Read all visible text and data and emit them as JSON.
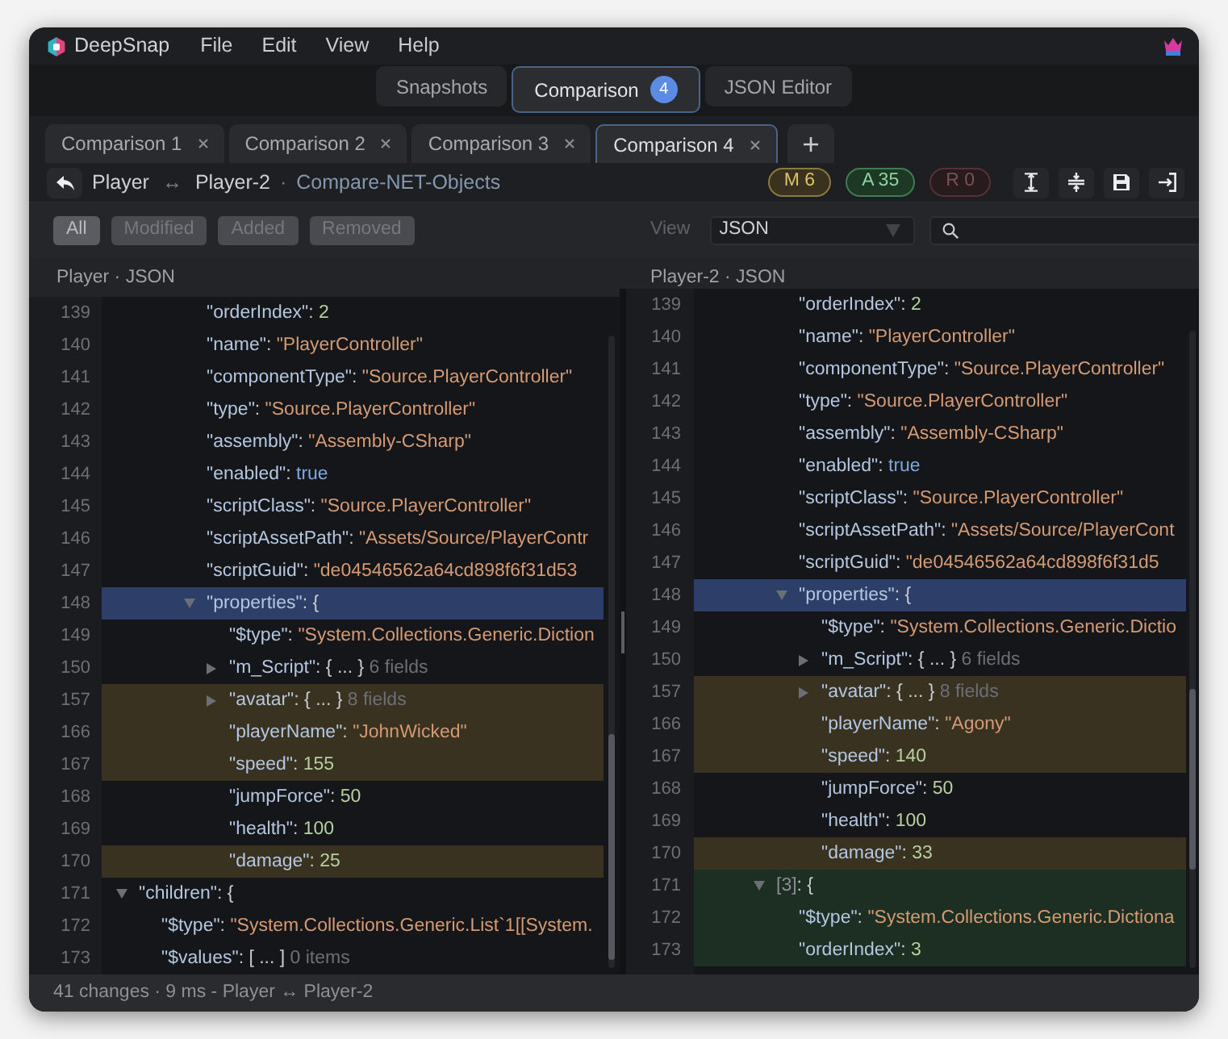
{
  "menu_bar": {
    "app_name": "DeepSnap",
    "menus": [
      "File",
      "Edit",
      "View",
      "Help"
    ]
  },
  "view_tabs": [
    {
      "label": "Snapshots",
      "selected": false
    },
    {
      "label": "Comparison",
      "selected": true,
      "badge": "4"
    },
    {
      "label": "JSON Editor",
      "selected": false
    }
  ],
  "comparison_tabs": [
    {
      "label": "Comparison 1",
      "selected": false
    },
    {
      "label": "Comparison 2",
      "selected": false
    },
    {
      "label": "Comparison 3",
      "selected": false
    },
    {
      "label": "Comparison 4",
      "selected": true
    }
  ],
  "breadcrumb": {
    "left": "Player",
    "link": "↔",
    "right": "Player-2",
    "separator": "·",
    "source": "Compare-NET-Objects"
  },
  "change_badges": [
    {
      "kind": "modified",
      "label": "M 6"
    },
    {
      "kind": "added",
      "label": "A 35"
    },
    {
      "kind": "removed",
      "label": "R 0"
    }
  ],
  "filters": [
    {
      "label": "All",
      "selected": true
    },
    {
      "label": "Modified",
      "selected": false
    },
    {
      "label": "Added",
      "selected": false
    },
    {
      "label": "Removed",
      "selected": false
    }
  ],
  "view_select": {
    "label": "View",
    "value": "JSON"
  },
  "panes": [
    {
      "title": "Player · JSON",
      "rows": [
        [
          [
            [
              {
                "line": "139",
                "selected": false,
                "modified": false,
                "added": false,
                "tokens": [
                  {
                    "kind": "key",
                    "text": "\"orderIndex\""
                  },
                  {
                    "kind": "punct",
                    "text": ": "
                  },
                  {
                    "kind": "number",
                    "text": "2"
                  }
                ]
              },
              {
                "line": "140",
                "selected": false,
                "modified": false,
                "added": false,
                "tokens": [
                  {
                    "kind": "key",
                    "text": "\"name\""
                  },
                  {
                    "kind": "punct",
                    "text": ": "
                  },
                  {
                    "kind": "string",
                    "text": "\"PlayerController\""
                  }
                ]
              },
              {
                "line": "141",
                "selected": false,
                "modified": false,
                "added": false,
                "tokens": [
                  {
                    "kind": "key",
                    "text": "\"componentType\""
                  },
                  {
                    "kind": "punct",
                    "text": ": "
                  },
                  {
                    "kind": "string",
                    "text": "\"Source.PlayerController\""
                  }
                ]
              },
              {
                "line": "142",
                "selected": false,
                "modified": false,
                "added": false,
                "tokens": [
                  {
                    "kind": "key",
                    "text": "\"type\""
                  },
                  {
                    "kind": "punct",
                    "text": ": "
                  },
                  {
                    "kind": "string",
                    "text": "\"Source.PlayerController\""
                  }
                ]
              },
              {
                "line": "143",
                "selected": false,
                "modified": false,
                "added": false,
                "tokens": [
                  {
                    "kind": "key",
                    "text": "\"assembly\""
                  },
                  {
                    "kind": "punct",
                    "text": ": "
                  },
                  {
                    "kind": "string",
                    "text": "\"Assembly-CSharp\""
                  }
                ]
              },
              {
                "line": "144",
                "selected": false,
                "modified": false,
                "added": false,
                "tokens": [
                  {
                    "kind": "key",
                    "text": "\"enabled\""
                  },
                  {
                    "kind": "punct",
                    "text": ": "
                  },
                  {
                    "kind": "bool",
                    "text": "true"
                  }
                ]
              },
              {
                "line": "145",
                "selected": false,
                "modified": false,
                "added": false,
                "tokens": [
                  {
                    "kind": "key",
                    "text": "\"scriptClass\""
                  },
                  {
                    "kind": "punct",
                    "text": ": "
                  },
                  {
                    "kind": "string",
                    "text": "\"Source.PlayerController\""
                  }
                ]
              },
              {
                "line": "146",
                "selected": false,
                "modified": false,
                "added": false,
                "tokens": [
                  {
                    "kind": "key",
                    "text": "\"scriptAssetPath\""
                  },
                  {
                    "kind": "punct",
                    "text": ": "
                  },
                  {
                    "kind": "string",
                    "text": "\"Assets/Source/PlayerContr"
                  }
                ]
              },
              {
                "line": "147",
                "selected": false,
                "modified": false,
                "added": false,
                "tokens": [
                  {
                    "kind": "key",
                    "text": "\"scriptGuid\""
                  },
                  {
                    "kind": "punct",
                    "text": ": "
                  },
                  {
                    "kind": "string",
                    "text": "\"de04546562a64cd898f6f31d53"
                  }
                ]
              },
              {
                "line": "148",
                "selected": true,
                "modified": false,
                "added": false,
                "expanded": true,
                "tokens": [
                  {
                    "kind": "key",
                    "text": "\"properties\""
                  },
                  {
                    "kind": "punct",
                    "text": ": {"
                  }
                ],
                "children": [
                  {
                    "line": "149",
                    "selected": false,
                    "modified": false,
                    "added": false,
                    "tokens": [
                      {
                        "kind": "key",
                        "text": "\"$type\""
                      },
                      {
                        "kind": "punct",
                        "text": ": "
                      },
                      {
                        "kind": "string",
                        "text": "\"System.Collections.Generic.Diction"
                      }
                    ]
                  },
                  {
                    "line": "150",
                    "selected": false,
                    "modified": false,
                    "added": false,
                    "expanded": false,
                    "tokens": [
                      {
                        "kind": "key",
                        "text": "\"m_Script\""
                      },
                      {
                        "kind": "punct",
                        "text": ": { ... } "
                      },
                      {
                        "kind": "summary",
                        "text": "6 fields"
                      }
                    ]
                  },
                  {
                    "line": "157",
                    "selected": false,
                    "modified": true,
                    "added": false,
                    "expanded": false,
                    "tokens": [
                      {
                        "kind": "key",
                        "text": "\"avatar\""
                      },
                      {
                        "kind": "punct",
                        "text": ": { ... } "
                      },
                      {
                        "kind": "summary",
                        "text": "8 fields"
                      }
                    ]
                  },
                  {
                    "line": "166",
                    "selected": false,
                    "modified": true,
                    "added": false,
                    "tokens": [
                      {
                        "kind": "key",
                        "text": "\"playerName\""
                      },
                      {
                        "kind": "punct",
                        "text": ": "
                      },
                      {
                        "kind": "string",
                        "text": "\"JohnWicked\""
                      }
                    ]
                  },
                  {
                    "line": "167",
                    "selected": false,
                    "modified": true,
                    "added": false,
                    "tokens": [
                      {
                        "kind": "key",
                        "text": "\"speed\""
                      },
                      {
                        "kind": "punct",
                        "text": ": "
                      },
                      {
                        "kind": "number",
                        "text": "155"
                      }
                    ]
                  },
                  {
                    "line": "168",
                    "selected": false,
                    "modified": false,
                    "added": false,
                    "tokens": [
                      {
                        "kind": "key",
                        "text": "\"jumpForce\""
                      },
                      {
                        "kind": "punct",
                        "text": ": "
                      },
                      {
                        "kind": "number",
                        "text": "50"
                      }
                    ]
                  },
                  {
                    "line": "169",
                    "selected": false,
                    "modified": false,
                    "added": false,
                    "tokens": [
                      {
                        "kind": "key",
                        "text": "\"health\""
                      },
                      {
                        "kind": "punct",
                        "text": ": "
                      },
                      {
                        "kind": "number",
                        "text": "100"
                      }
                    ]
                  },
                  {
                    "line": "170",
                    "selected": false,
                    "modified": true,
                    "added": false,
                    "tokens": [
                      {
                        "kind": "key",
                        "text": "\"damage\""
                      },
                      {
                        "kind": "punct",
                        "text": ": "
                      },
                      {
                        "kind": "number",
                        "text": "25"
                      }
                    ]
                  }
                ]
              }
            ]
          ]
        ],
        {
          "line": "171",
          "selected": false,
          "modified": false,
          "added": false,
          "expanded": true,
          "tokens": [
            {
              "kind": "key",
              "text": "\"children\""
            },
            {
              "kind": "punct",
              "text": ": {"
            }
          ],
          "children": [
            {
              "line": "172",
              "selected": false,
              "modified": false,
              "added": false,
              "tokens": [
                {
                  "kind": "key",
                  "text": "\"$type\""
                },
                {
                  "kind": "punct",
                  "text": ": "
                },
                {
                  "kind": "string",
                  "text": "\"System.Collections.Generic.List`1[[System."
                }
              ]
            },
            {
              "line": "173",
              "selected": false,
              "modified": false,
              "added": false,
              "tokens": [
                {
                  "kind": "key",
                  "text": "\"$values\""
                },
                {
                  "kind": "punct",
                  "text": ": [ ... ] "
                },
                {
                  "kind": "summary",
                  "text": "0 items"
                }
              ]
            }
          ]
        }
      ]
    },
    {
      "title": "Player-2 · JSON",
      "rows": [
        [
          [
            [
              {
                "line": "139",
                "selected": false,
                "modified": false,
                "added": false,
                "tokens": [
                  {
                    "kind": "key",
                    "text": "\"orderIndex\""
                  },
                  {
                    "kind": "punct",
                    "text": ": "
                  },
                  {
                    "kind": "number",
                    "text": "2"
                  }
                ]
              },
              {
                "line": "140",
                "selected": false,
                "modified": false,
                "added": false,
                "tokens": [
                  {
                    "kind": "key",
                    "text": "\"name\""
                  },
                  {
                    "kind": "punct",
                    "text": ": "
                  },
                  {
                    "kind": "string",
                    "text": "\"PlayerController\""
                  }
                ]
              },
              {
                "line": "141",
                "selected": false,
                "modified": false,
                "added": false,
                "tokens": [
                  {
                    "kind": "key",
                    "text": "\"componentType\""
                  },
                  {
                    "kind": "punct",
                    "text": ": "
                  },
                  {
                    "kind": "string",
                    "text": "\"Source.PlayerController\""
                  }
                ]
              },
              {
                "line": "142",
                "selected": false,
                "modified": false,
                "added": false,
                "tokens": [
                  {
                    "kind": "key",
                    "text": "\"type\""
                  },
                  {
                    "kind": "punct",
                    "text": ": "
                  },
                  {
                    "kind": "string",
                    "text": "\"Source.PlayerController\""
                  }
                ]
              },
              {
                "line": "143",
                "selected": false,
                "modified": false,
                "added": false,
                "tokens": [
                  {
                    "kind": "key",
                    "text": "\"assembly\""
                  },
                  {
                    "kind": "punct",
                    "text": ": "
                  },
                  {
                    "kind": "string",
                    "text": "\"Assembly-CSharp\""
                  }
                ]
              },
              {
                "line": "144",
                "selected": false,
                "modified": false,
                "added": false,
                "tokens": [
                  {
                    "kind": "key",
                    "text": "\"enabled\""
                  },
                  {
                    "kind": "punct",
                    "text": ": "
                  },
                  {
                    "kind": "bool",
                    "text": "true"
                  }
                ]
              },
              {
                "line": "145",
                "selected": false,
                "modified": false,
                "added": false,
                "tokens": [
                  {
                    "kind": "key",
                    "text": "\"scriptClass\""
                  },
                  {
                    "kind": "punct",
                    "text": ": "
                  },
                  {
                    "kind": "string",
                    "text": "\"Source.PlayerController\""
                  }
                ]
              },
              {
                "line": "146",
                "selected": false,
                "modified": false,
                "added": false,
                "tokens": [
                  {
                    "kind": "key",
                    "text": "\"scriptAssetPath\""
                  },
                  {
                    "kind": "punct",
                    "text": ": "
                  },
                  {
                    "kind": "string",
                    "text": "\"Assets/Source/PlayerCont"
                  }
                ]
              },
              {
                "line": "147",
                "selected": false,
                "modified": false,
                "added": false,
                "tokens": [
                  {
                    "kind": "key",
                    "text": "\"scriptGuid\""
                  },
                  {
                    "kind": "punct",
                    "text": ": "
                  },
                  {
                    "kind": "string",
                    "text": "\"de04546562a64cd898f6f31d5"
                  }
                ]
              },
              {
                "line": "148",
                "selected": true,
                "modified": false,
                "added": false,
                "expanded": true,
                "tokens": [
                  {
                    "kind": "key",
                    "text": "\"properties\""
                  },
                  {
                    "kind": "punct",
                    "text": ": {"
                  }
                ],
                "children": [
                  {
                    "line": "149",
                    "selected": false,
                    "modified": false,
                    "added": false,
                    "tokens": [
                      {
                        "kind": "key",
                        "text": "\"$type\""
                      },
                      {
                        "kind": "punct",
                        "text": ": "
                      },
                      {
                        "kind": "string",
                        "text": "\"System.Collections.Generic.Dictio"
                      }
                    ]
                  },
                  {
                    "line": "150",
                    "selected": false,
                    "modified": false,
                    "added": false,
                    "expanded": false,
                    "tokens": [
                      {
                        "kind": "key",
                        "text": "\"m_Script\""
                      },
                      {
                        "kind": "punct",
                        "text": ": { ... } "
                      },
                      {
                        "kind": "summary",
                        "text": "6 fields"
                      }
                    ]
                  },
                  {
                    "line": "157",
                    "selected": false,
                    "modified": true,
                    "added": false,
                    "expanded": false,
                    "tokens": [
                      {
                        "kind": "key",
                        "text": "\"avatar\""
                      },
                      {
                        "kind": "punct",
                        "text": ": { ... } "
                      },
                      {
                        "kind": "summary",
                        "text": "8 fields"
                      }
                    ]
                  },
                  {
                    "line": "166",
                    "selected": false,
                    "modified": true,
                    "added": false,
                    "tokens": [
                      {
                        "kind": "key",
                        "text": "\"playerName\""
                      },
                      {
                        "kind": "punct",
                        "text": ": "
                      },
                      {
                        "kind": "string",
                        "text": "\"Agony\""
                      }
                    ]
                  },
                  {
                    "line": "167",
                    "selected": false,
                    "modified": true,
                    "added": false,
                    "tokens": [
                      {
                        "kind": "key",
                        "text": "\"speed\""
                      },
                      {
                        "kind": "punct",
                        "text": ": "
                      },
                      {
                        "kind": "number",
                        "text": "140"
                      }
                    ]
                  },
                  {
                    "line": "168",
                    "selected": false,
                    "modified": false,
                    "added": false,
                    "tokens": [
                      {
                        "kind": "key",
                        "text": "\"jumpForce\""
                      },
                      {
                        "kind": "punct",
                        "text": ": "
                      },
                      {
                        "kind": "number",
                        "text": "50"
                      }
                    ]
                  },
                  {
                    "line": "169",
                    "selected": false,
                    "modified": false,
                    "added": false,
                    "tokens": [
                      {
                        "kind": "key",
                        "text": "\"health\""
                      },
                      {
                        "kind": "punct",
                        "text": ": "
                      },
                      {
                        "kind": "number",
                        "text": "100"
                      }
                    ]
                  },
                  {
                    "line": "170",
                    "selected": false,
                    "modified": true,
                    "added": false,
                    "tokens": [
                      {
                        "kind": "key",
                        "text": "\"damage\""
                      },
                      {
                        "kind": "punct",
                        "text": ": "
                      },
                      {
                        "kind": "number",
                        "text": "33"
                      }
                    ]
                  }
                ]
              }
            ],
            {
              "line": "171",
              "selected": false,
              "modified": false,
              "added": true,
              "expanded": true,
              "tokens": [
                {
                  "kind": "index",
                  "text": "[3]"
                },
                {
                  "kind": "punct",
                  "text": ": {"
                }
              ],
              "children": [
                {
                  "line": "172",
                  "selected": false,
                  "modified": false,
                  "added": true,
                  "tokens": [
                    {
                      "kind": "key",
                      "text": "\"$type\""
                    },
                    {
                      "kind": "punct",
                      "text": ": "
                    },
                    {
                      "kind": "string",
                      "text": "\"System.Collections.Generic.Dictiona"
                    }
                  ]
                },
                {
                  "line": "173",
                  "selected": false,
                  "modified": false,
                  "added": true,
                  "tokens": [
                    {
                      "kind": "key",
                      "text": "\"orderIndex\""
                    },
                    {
                      "kind": "punct",
                      "text": ": "
                    },
                    {
                      "kind": "number",
                      "text": "3"
                    }
                  ]
                }
              ]
            }
          ]
        ]
      ]
    }
  ],
  "status_bar": "41 changes · 9 ms - Player ↔ Player-2"
}
